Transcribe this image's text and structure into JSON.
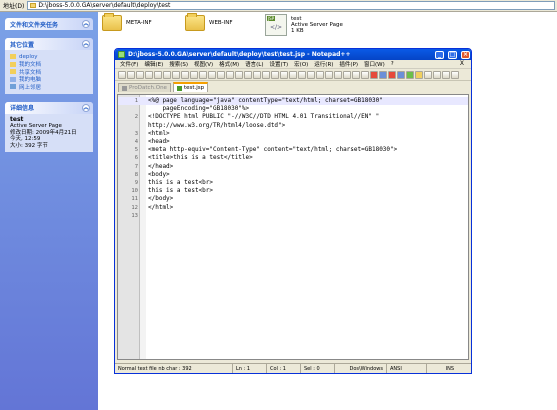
{
  "address_bar": {
    "label": "地址(D)",
    "path": "D:\\jboss-5.0.0.GA\\server\\default\\deploy\\test"
  },
  "sidebar": {
    "tasks_title": "文件和文件夹任务",
    "places_title": "其它位置",
    "places": [
      {
        "label": "deploy"
      },
      {
        "label": "我的文档"
      },
      {
        "label": "共享文档"
      },
      {
        "label": "我的电脑"
      },
      {
        "label": "网上邻居"
      }
    ],
    "details_title": "详细信息",
    "details": {
      "name": "test",
      "type": "Active Server Page",
      "modified": "修改日期: 2009年4月21日",
      "modified_time": "今天, 12:59",
      "size": "大小: 392 字节"
    }
  },
  "files": [
    {
      "name": "META-INF",
      "icon": "folder-icon"
    },
    {
      "name": "WEB-INF",
      "icon": "folder-icon"
    },
    {
      "name": "test",
      "type": "Active Server Page",
      "size": "1 KB",
      "icon": "jsp-file-icon",
      "badge": "JSP"
    }
  ],
  "notepad": {
    "title": "D:\\jboss-5.0.0.GA\\server\\default\\deploy\\test\\test.jsp - Notepad++",
    "menu": [
      "文件(F)",
      "编辑(E)",
      "搜索(S)",
      "视图(V)",
      "格式(M)",
      "语言(L)",
      "设置(T)",
      "宏(O)",
      "运行(R)",
      "插件(P)",
      "窗口(W)",
      "?"
    ],
    "menu_close": "X",
    "tabs": [
      {
        "label": "ProDatch.One",
        "active": false
      },
      {
        "label": "test.jsp",
        "active": true
      }
    ],
    "lines": [
      "<%@ page language=\"java\" contentType=\"text/html; charset=GB18030\"",
      "    pageEncoding=\"GB18030\"%>",
      "<!DOCTYPE html PUBLIC \"-//W3C//DTD HTML 4.01 Transitional//EN\" \"",
      "http://www.w3.org/TR/html4/loose.dtd\">",
      "<html>",
      "<head>",
      "<meta http-equiv=\"Content-Type\" content=\"text/html; charset=GB18030\">",
      "<title>this is a test</title>",
      "</head>",
      "<body>",
      "this is a test<br>",
      "this is a test<br>",
      "</body>",
      "</html>"
    ],
    "line_numbers": [
      "1",
      "",
      "2",
      "",
      "3",
      "4",
      "5",
      "6",
      "7",
      "8",
      "9",
      "10",
      "11",
      "12",
      "13"
    ],
    "status": {
      "type": "Normal text file nb char : 392",
      "ln": "Ln : 1",
      "col": "Col : 1",
      "sel": "Sel : 0",
      "eol": "Dos\\Windows",
      "enc": "ANSI",
      "ins": "INS"
    }
  }
}
